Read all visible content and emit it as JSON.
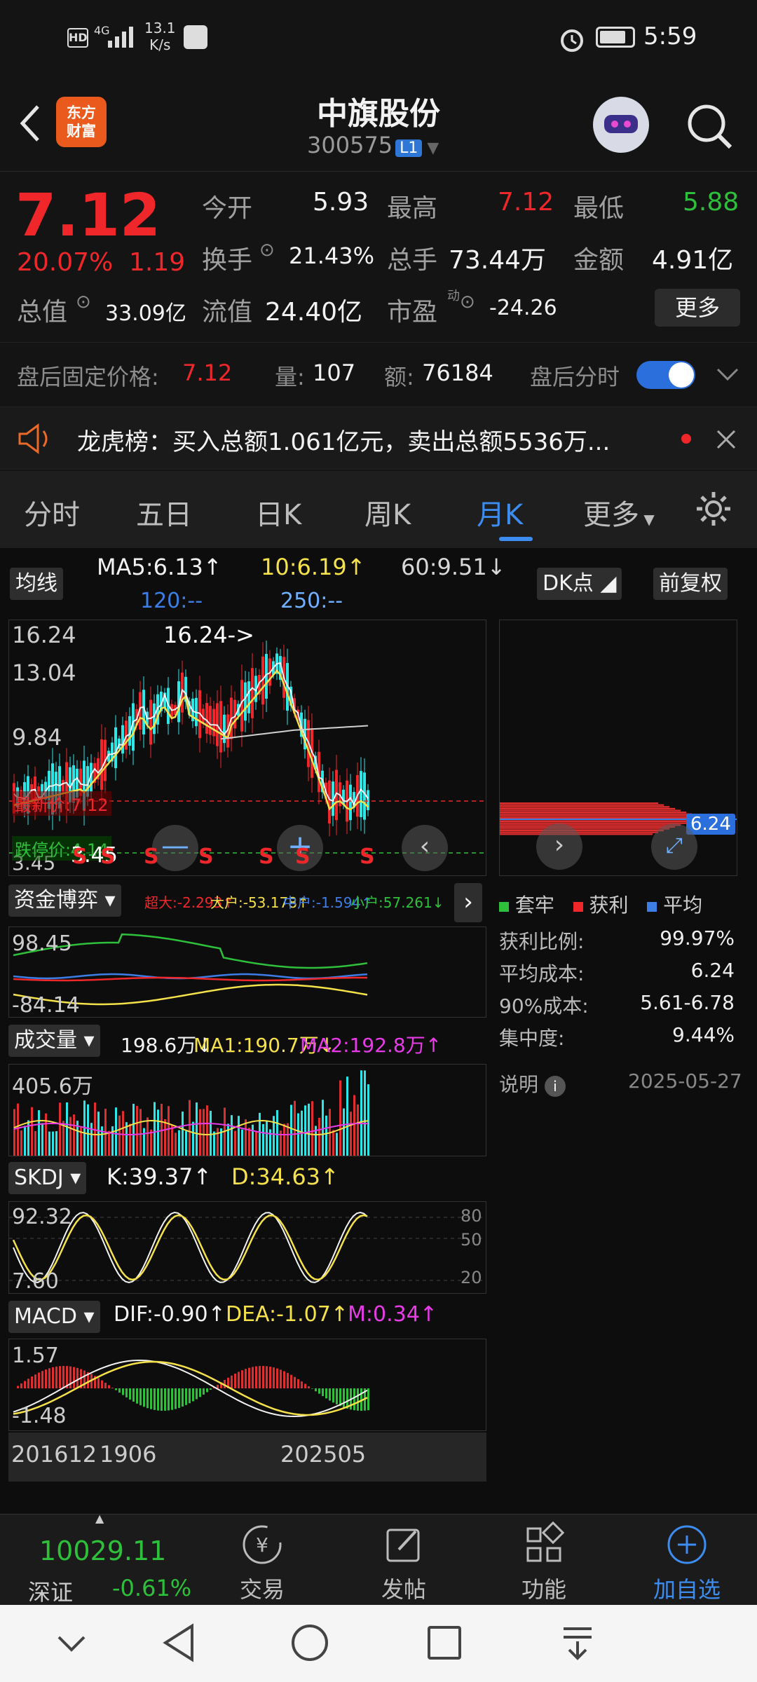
{
  "status_bar": {
    "network_speed_value": "13.1",
    "network_speed_unit": "K/s",
    "signal_label": "4G",
    "time": "5:59"
  },
  "header": {
    "app_logo_line1": "东方",
    "app_logo_line2": "财富",
    "stock_name": "中旗股份",
    "stock_code": "300575",
    "level_badge": "L1"
  },
  "quote": {
    "price": "7.12",
    "change_pct": "20.07%",
    "change_amt": "1.19",
    "open_label": "今开",
    "open": "5.93",
    "high_label": "最高",
    "high": "7.12",
    "low_label": "最低",
    "low": "5.88",
    "turnover_label": "换手",
    "turnover": "21.43%",
    "volume_label": "总手",
    "volume": "73.44万",
    "amount_label": "金额",
    "amount": "4.91亿",
    "mktcap_label": "总值",
    "mktcap": "33.09亿",
    "float_label": "流值",
    "float": "24.40亿",
    "pe_label": "市盈",
    "pe_sup": "动",
    "pe": "-24.26",
    "more_label": "更多"
  },
  "after_hours": {
    "price_label": "盘后固定价格:",
    "price": "7.12",
    "vol_label": "量:",
    "vol": "107",
    "amt_label": "额:",
    "amt": "76184",
    "toggle_label": "盘后分时"
  },
  "notice": {
    "text": "龙虎榜：买入总额1.061亿元，卖出总额5536万..."
  },
  "tabs": {
    "items": [
      "分时",
      "五日",
      "日K",
      "周K",
      "月K",
      "更多"
    ],
    "active": "月K"
  },
  "chart_header": {
    "ma_chip": "均线",
    "ma5": "MA5:6.13",
    "ma10": "10:6.19",
    "ma60": "60:9.51",
    "ma120": "120:--",
    "ma250": "250:--",
    "dk_chip": "DK点",
    "adjust_chip": "前复权"
  },
  "main_chart": {
    "y_labels": [
      "16.24",
      "13.04",
      "9.84",
      "3.45"
    ],
    "max_marker": "16.24->",
    "min_marker": "3.45",
    "price_line_label": "最新价:7.12",
    "cost_line_label": "跌停价:4.14",
    "signal_letters": [
      "S",
      "S",
      "S",
      "S",
      "S",
      "S",
      "S"
    ],
    "colors": {
      "up": "#f0272a",
      "down": "#2ee6e6",
      "ma5": "#f2f2f2",
      "ma10": "#f5e14a",
      "ma60": "#d0d0d0"
    }
  },
  "fund_game": {
    "chip": "资金博弈",
    "super": "超大:-2.293",
    "large": "大户:-53.178",
    "mid": "中户:-1.594",
    "small": "小户:57.261",
    "y_top": "98.45",
    "y_bottom": "-84.14"
  },
  "volume_panel": {
    "chip": "成交量",
    "vol": "198.6万",
    "ma1": "MA1:190.7万",
    "ma2": "MA2:192.8万",
    "y_top": "405.6万"
  },
  "skdj_panel": {
    "chip": "SKDJ",
    "k": "K:39.37",
    "d": "D:34.63",
    "y_top": "92.32",
    "y_bottom": "7.60",
    "levels": [
      "80",
      "50",
      "20"
    ]
  },
  "macd_panel": {
    "chip": "MACD",
    "dif": "DIF:-0.90",
    "dea": "DEA:-1.07",
    "m": "M:0.34",
    "y_top": "1.57",
    "y_bottom": "-1.48"
  },
  "x_axis": {
    "start": "201612",
    "mid": "1906",
    "end": "202505"
  },
  "chip_dist": {
    "cost_tag": "6.24",
    "legend": [
      "套牢",
      "获利",
      "平均"
    ],
    "rows": [
      {
        "label": "获利比例:",
        "value": "99.97%"
      },
      {
        "label": "平均成本:",
        "value": "6.24"
      },
      {
        "label": "90%成本:",
        "value": "5.61-6.78"
      },
      {
        "label": "集中度:",
        "value": "9.44%"
      }
    ],
    "note_label": "说明",
    "date": "2025-05-27"
  },
  "bottom_bar": {
    "index_value": "10029.11",
    "index_name": "深证",
    "index_change": "-0.61%",
    "items": [
      "交易",
      "发帖",
      "功能",
      "加自选"
    ]
  }
}
